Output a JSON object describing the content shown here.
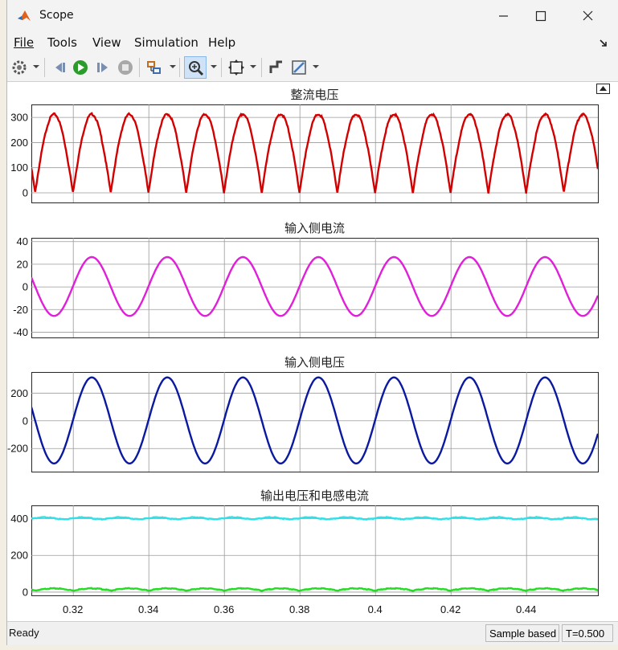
{
  "window": {
    "title": "Scope",
    "icon": "matlab-icon"
  },
  "menu": [
    {
      "label": "File"
    },
    {
      "label": "Tools"
    },
    {
      "label": "View"
    },
    {
      "label": "Simulation"
    },
    {
      "label": "Help"
    }
  ],
  "toolbar": [
    "settings-icon",
    "step-back-icon",
    "run-icon",
    "step-forward-icon",
    "stop-icon",
    "highlight-block-icon",
    "zoom-in-icon",
    "fit-view-icon",
    "cursor-measure-icon",
    "style-icon"
  ],
  "status": {
    "text": "Ready",
    "mode": "Sample based",
    "time": "T=0.500"
  },
  "colors": {
    "red": "#d20000",
    "magenta": "#e020d8",
    "blue": "#0a19a0",
    "cyan": "#30e0e8",
    "green": "#22dd22"
  },
  "chart_data": [
    {
      "type": "line",
      "title": "整流电压",
      "xlim": [
        0.309,
        0.459
      ],
      "ylim": [
        -40,
        350
      ],
      "yticks": [
        "0",
        "100",
        "200",
        "300"
      ],
      "xticks": [
        "0.32",
        "0.34",
        "0.36",
        "0.38",
        "0.4",
        "0.42",
        "0.44"
      ],
      "grid": true,
      "series": [
        {
          "color": "#d20000",
          "shape": "rectified sine |sin|",
          "peak": 311,
          "frequency_hz": 50,
          "ripple_noise": 4
        }
      ]
    },
    {
      "type": "line",
      "title": "输入侧电流",
      "xlim": [
        0.309,
        0.459
      ],
      "ylim": [
        -45,
        43
      ],
      "yticks": [
        "40",
        "20",
        "0",
        "-20",
        "-40"
      ],
      "xticks": [
        "0.32",
        "0.34",
        "0.36",
        "0.38",
        "0.4",
        "0.42",
        "0.44"
      ],
      "grid": true,
      "series": [
        {
          "color": "#e020d8",
          "shape": "sine",
          "amplitude": 26,
          "frequency_hz": 50,
          "phase_zero_rising_at": 0.3
        }
      ]
    },
    {
      "type": "line",
      "title": "输入侧电压",
      "xlim": [
        0.309,
        0.459
      ],
      "ylim": [
        -370,
        350
      ],
      "yticks": [
        "200",
        "0",
        "-200"
      ],
      "xticks": [
        "0.32",
        "0.34",
        "0.36",
        "0.38",
        "0.4",
        "0.42",
        "0.44"
      ],
      "grid": true,
      "series": [
        {
          "color": "#0a19a0",
          "shape": "sine",
          "amplitude": 311,
          "frequency_hz": 50,
          "phase_zero_rising_at": 0.3
        }
      ]
    },
    {
      "type": "line",
      "title": "输出电压和电感电流",
      "xlim": [
        0.309,
        0.459
      ],
      "ylim": [
        -20,
        470
      ],
      "yticks": [
        "400",
        "200",
        "0"
      ],
      "xticks": [
        "0.32",
        "0.34",
        "0.36",
        "0.38",
        "0.4",
        "0.42",
        "0.44"
      ],
      "grid": true,
      "series": [
        {
          "color": "#30e0e8",
          "shape": "dc with ripple",
          "level": 400,
          "ripple": 5,
          "ripple_frequency_hz": 100
        },
        {
          "color": "#22dd22",
          "shape": "rectified ripple",
          "level": 12,
          "ripple": 12,
          "ripple_frequency_hz": 100
        }
      ]
    }
  ]
}
